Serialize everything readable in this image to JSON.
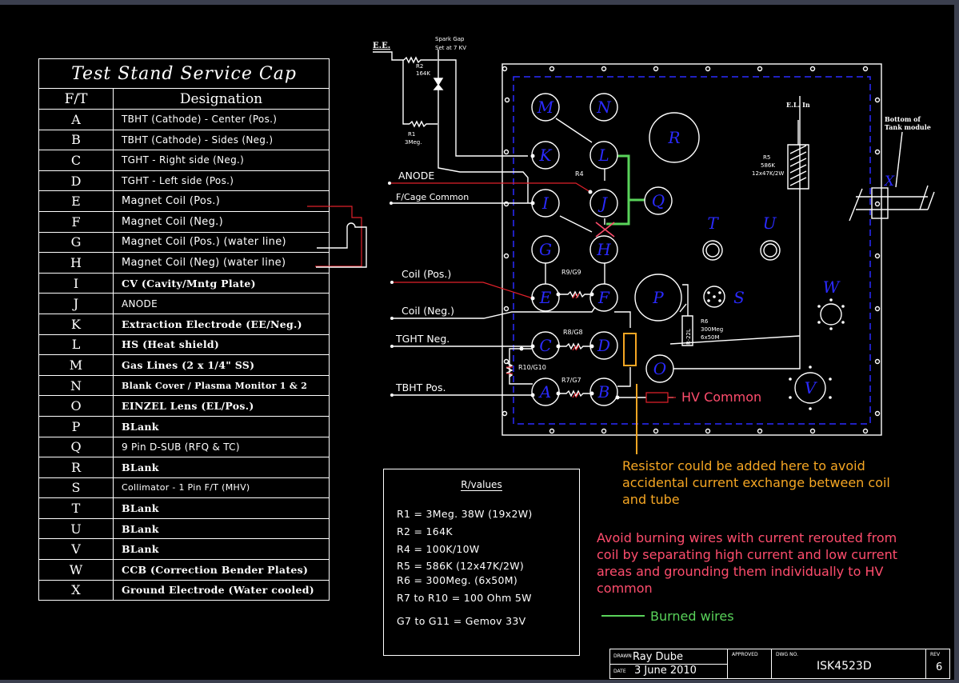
{
  "table": {
    "title": "Test Stand Service Cap",
    "col_ft": "F/T",
    "col_designation": "Designation",
    "rows": [
      {
        "ft": "A",
        "designation": "TBHT (Cathode) - Center (Pos.)"
      },
      {
        "ft": "B",
        "designation": "TBHT (Cathode) - Sides (Neg.)"
      },
      {
        "ft": "C",
        "designation": "TGHT - Right side (Neg.)"
      },
      {
        "ft": "D",
        "designation": "TGHT - Left side (Pos.)"
      },
      {
        "ft": "E",
        "designation": "Magnet Coil (Pos.)"
      },
      {
        "ft": "F",
        "designation": "Magnet Coil (Neg.)"
      },
      {
        "ft": "G",
        "designation": "Magnet Coil (Pos.) (water line)"
      },
      {
        "ft": "H",
        "designation": "Magnet Coil (Neg) (water line)"
      },
      {
        "ft": "I",
        "designation": "CV (Cavity/Mntg Plate)"
      },
      {
        "ft": "J",
        "designation": "ANODE"
      },
      {
        "ft": "K",
        "designation": "Extraction Electrode (EE/Neg.)"
      },
      {
        "ft": "L",
        "designation": "HS (Heat shield)"
      },
      {
        "ft": "M",
        "designation": "Gas Lines (2 x 1/4\" SS)"
      },
      {
        "ft": "N",
        "designation": "Blank Cover / Plasma Monitor 1 & 2"
      },
      {
        "ft": "O",
        "designation": "EINZEL Lens (EL/Pos.)"
      },
      {
        "ft": "P",
        "designation": "BLank"
      },
      {
        "ft": "Q",
        "designation": "9 Pin D-SUB (RFQ & TC)"
      },
      {
        "ft": "R",
        "designation": "BLank"
      },
      {
        "ft": "S",
        "designation": "Collimator - 1 Pin F/T (MHV)"
      },
      {
        "ft": "T",
        "designation": "BLank"
      },
      {
        "ft": "U",
        "designation": "BLank"
      },
      {
        "ft": "V",
        "designation": "BLank"
      },
      {
        "ft": "W",
        "designation": "CCB (Correction Bender Plates)"
      },
      {
        "ft": "X",
        "designation": "Ground Electrode (Water cooled)"
      }
    ]
  },
  "rvalues": {
    "title": "R/values",
    "lines": [
      "R1 = 3Meg. 38W (19x2W)",
      "R2 = 164K",
      "R4 = 100K/10W",
      "R5 = 586K (12x47K/2W)",
      "R6 = 300Meg. (6x50M)",
      "R7 to R10 = 100 Ohm 5W",
      "G7 to G11 = Gemov 33V"
    ]
  },
  "schematic": {
    "ee": "E.E.",
    "spark_gap": "Spark Gap",
    "spark_set": "Set at 7 KV",
    "r2": "R2",
    "r2_val": "164K",
    "r1": "R1",
    "r1_val": "3Meg.",
    "anode": "ANODE",
    "fcage": "F/Cage Common",
    "coil_pos": "Coil (Pos.)",
    "coil_neg": "Coil (Neg.)",
    "tght_neg": "TGHT Neg.",
    "tbht_pos": "TBHT Pos.",
    "hv_common": "HV Common",
    "r4": "R4",
    "r9g9": "R9/G9",
    "r8g8": "R8/G8",
    "r7g7": "R7/G7",
    "r10g10": "R10/G10",
    "el_in": "E.L. In",
    "r5": "R5",
    "r5_val1": "586K",
    "r5_val2": "12x47K/2W",
    "r6": "R6",
    "r6_val1": "300Meg",
    "r6_val2": "6x50M",
    "r6_box": "R-22L",
    "bottom1": "Bottom of",
    "bottom2": "Tank module",
    "x_label": "X",
    "ft_labels": [
      "M",
      "N",
      "R",
      "K",
      "L",
      "I",
      "J",
      "Q",
      "H",
      "T",
      "U",
      "G",
      "E",
      "F",
      "P",
      "S",
      "W",
      "C",
      "D",
      "O",
      "A",
      "B",
      "V"
    ]
  },
  "notes": {
    "resistor": [
      "Resistor could be added here to avoid",
      "accidental current exchange between coil",
      "and tube"
    ],
    "avoid": [
      "Avoid burning wires with current rerouted from",
      "coil by separating high current and low current",
      "areas and grounding them individually to HV",
      "common"
    ],
    "burned": "Burned wires"
  },
  "title_block": {
    "drawn_label": "DRAWN",
    "drawn_by": "Ray Dube",
    "date_label": "DATE",
    "date": "3 June 2010",
    "approved_label": "APPROVED",
    "dwg_label": "DWG NO.",
    "dwg_no": "ISK4523D",
    "rev_label": "REV",
    "rev": "6"
  },
  "colors": {
    "background": "#000000",
    "line": "#ffffff",
    "ft_letters": "#2a2aff",
    "dashed_border": "#2a2aff",
    "red_wire": "#e0202a",
    "green_burned": "#59d35a",
    "orange_note": "#f5a623",
    "pink_note": "#ff4d6d"
  }
}
